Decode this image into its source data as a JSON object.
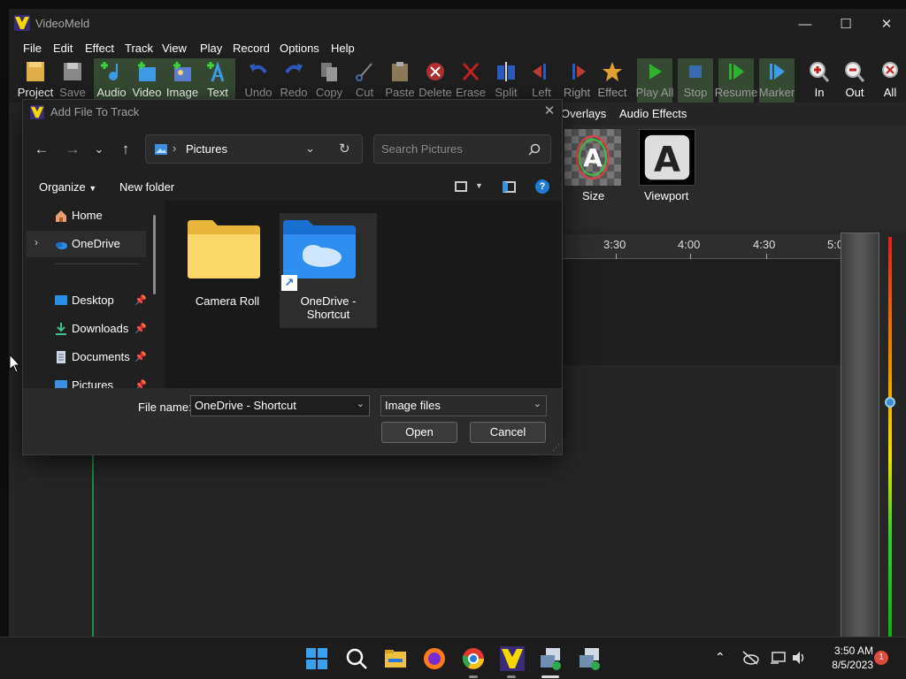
{
  "app": {
    "title": "VideoMeld",
    "menus": [
      "File",
      "Edit",
      "Effect",
      "Track",
      "View",
      "Play",
      "Record",
      "Options",
      "Help"
    ]
  },
  "toolbar": [
    "Project",
    "Save",
    "Audio",
    "Video",
    "Image",
    "Text",
    "Undo",
    "Redo",
    "Copy",
    "Cut",
    "Paste",
    "Delete",
    "Erase",
    "Split",
    "Left",
    "Right",
    "Effect",
    "Play All",
    "Stop",
    "Resume",
    "Marker",
    "In",
    "Out",
    "All"
  ],
  "effects": {
    "tabs": [
      "Overlays",
      "Audio Effects"
    ],
    "tiles": [
      "Size",
      "Viewport"
    ]
  },
  "timeline": {
    "ticks": [
      "3:30",
      "4:00",
      "4:30",
      "5:0"
    ]
  },
  "dialog": {
    "title": "Add File To Track",
    "address": "Pictures",
    "search_placeholder": "Search Pictures",
    "organize": "Organize",
    "new_folder": "New folder",
    "nav": [
      "Home",
      "OneDrive",
      "Desktop",
      "Downloads",
      "Documents",
      "Pictures"
    ],
    "files": [
      {
        "name": "Camera Roll"
      },
      {
        "name": "OneDrive - Shortcut"
      }
    ],
    "filename_label": "File name:",
    "filename_value": "OneDrive - Shortcut",
    "filetype": "Image files",
    "open": "Open",
    "cancel": "Cancel"
  },
  "taskbar": {
    "time": "3:50 AM",
    "date": "8/5/2023",
    "notifications": "1"
  }
}
